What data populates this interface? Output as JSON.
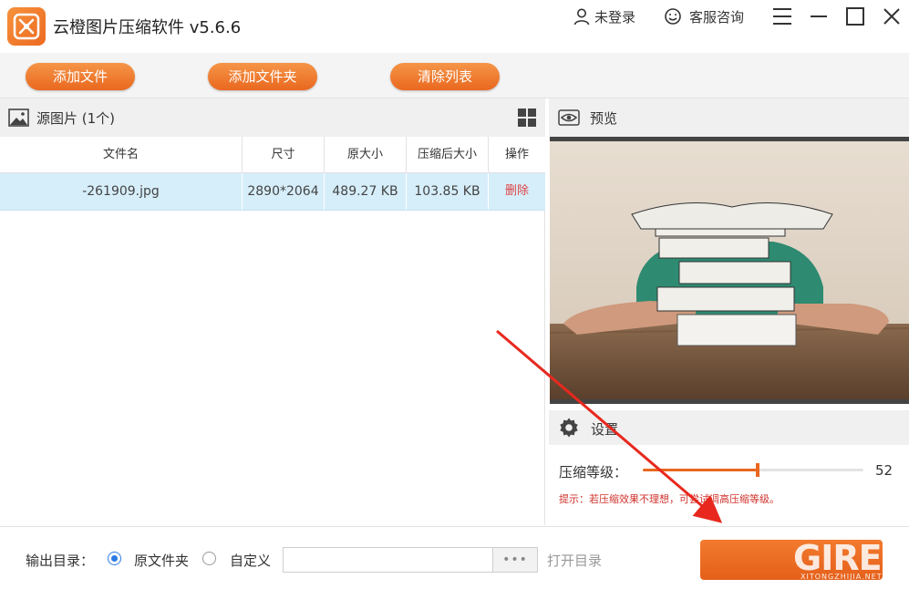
{
  "app": {
    "title": "云橙图片压缩软件 v5.6.6",
    "login_label": "未登录",
    "service_label": "客服咨询",
    "accent_color": "#e9681f"
  },
  "toolbar": {
    "add_file": "添加文件",
    "add_folder": "添加文件夹",
    "clear_list": "清除列表"
  },
  "source_panel": {
    "title": "源图片 (1个)",
    "columns": [
      "文件名",
      "尺寸",
      "原大小",
      "压缩后大小",
      "操作"
    ],
    "rows": [
      {
        "name": "-261909.jpg",
        "size": "2890*2064",
        "original": "489.27 KB",
        "compressed": "103.85 KB",
        "action": "删除"
      }
    ]
  },
  "preview": {
    "title": "预览"
  },
  "settings": {
    "title": "设置",
    "level_label": "压缩等级：",
    "level_value": "52",
    "level_percent": 52,
    "tip": "提示：若压缩效果不理想，可尝试调高压缩等级。"
  },
  "output": {
    "label": "输出目录：",
    "option_original": "原文件夹",
    "option_custom": "自定义",
    "selected": "原文件夹",
    "path_value": "",
    "browse_label": "•••",
    "open_dir": "打开目录"
  },
  "watermark": {
    "main": "GIRE",
    "sub": "XITONGZHIJIA.NET"
  }
}
